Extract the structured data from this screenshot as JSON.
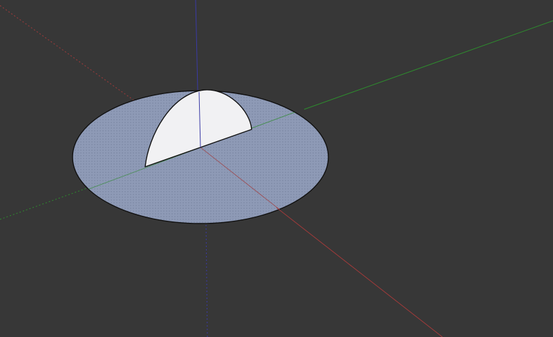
{
  "viewport": {
    "background_color": "#373737"
  },
  "axes": {
    "red_axis_color": "#a23a3a",
    "green_axis_color": "#2e8b2e",
    "blue_axis_color": "#3a3aa6"
  },
  "model": {
    "disk_face_color": "#8e9ab6",
    "disk_texture_dot_color": "#6c7894",
    "half_disk_color": "#f1f1f3",
    "edge_color": "#111111"
  }
}
